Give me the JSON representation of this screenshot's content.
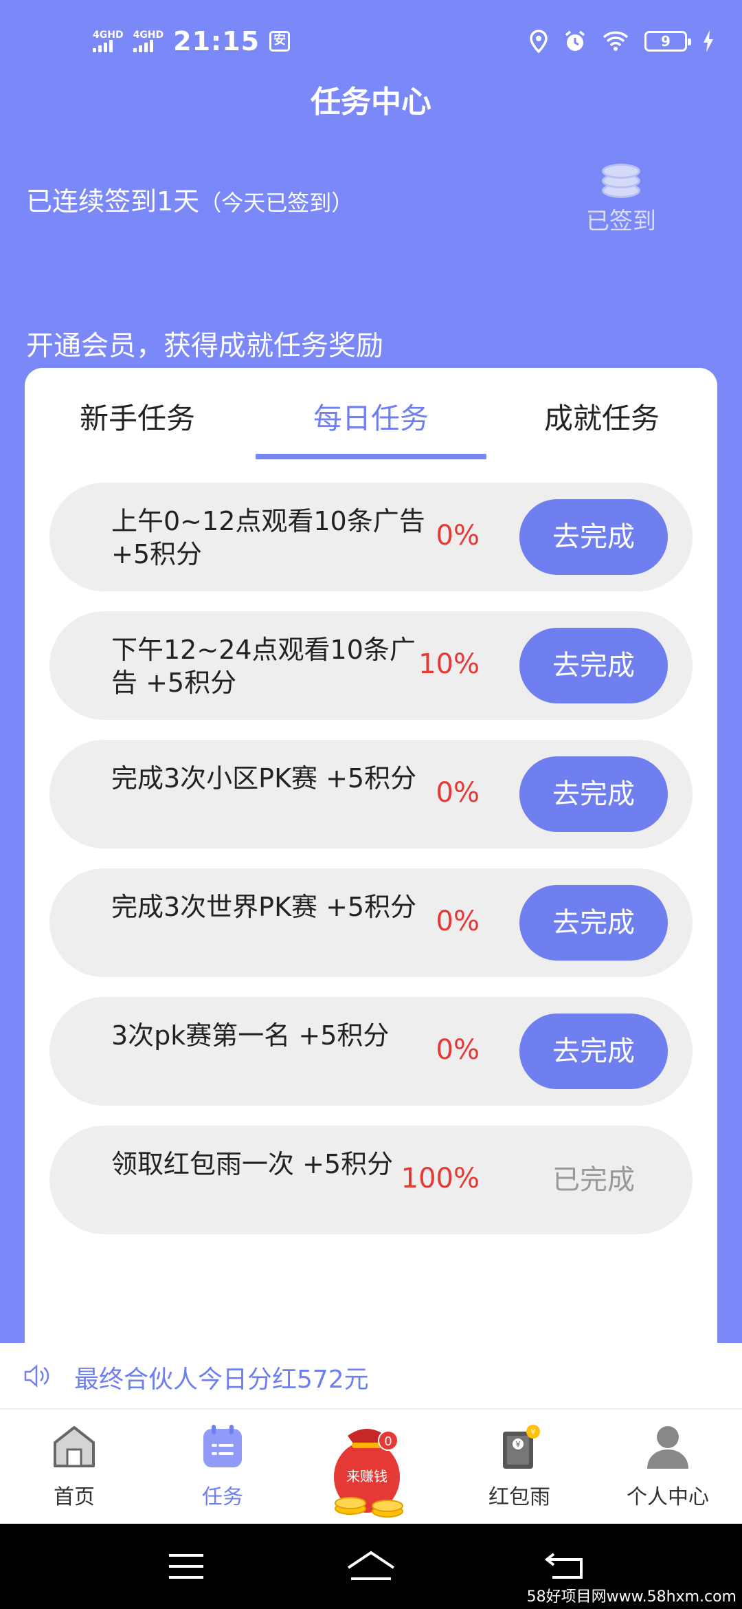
{
  "status_bar": {
    "network_1": "4GHD",
    "network_2": "4GHD",
    "time": "21:15",
    "app_icon_glyph": "安",
    "battery": "9",
    "icons": [
      "location-icon",
      "alarm-icon",
      "wifi-icon",
      "battery-icon",
      "charging-icon"
    ]
  },
  "header": {
    "title": "任务中心"
  },
  "checkin": {
    "text": "已连续签到1天",
    "note": "（今天已签到）",
    "button_label": "已签到"
  },
  "promo_text": "开通会员，获得成就任务奖励",
  "tabs": [
    {
      "label": "新手任务",
      "active": false
    },
    {
      "label": "每日任务",
      "active": true
    },
    {
      "label": "成就任务",
      "active": false
    }
  ],
  "tasks": [
    {
      "title": "上午0~12点观看10条广告  +5积分",
      "progress": "0%",
      "action": "去完成",
      "done": false
    },
    {
      "title": "下午12~24点观看10条广告  +5积分",
      "progress": "10%",
      "action": "去完成",
      "done": false
    },
    {
      "title": "完成3次小区PK赛  +5积分",
      "progress": "0%",
      "action": "去完成",
      "done": false
    },
    {
      "title": "完成3次世界PK赛  +5积分",
      "progress": "0%",
      "action": "去完成",
      "done": false
    },
    {
      "title": "3次pk赛第一名  +5积分",
      "progress": "0%",
      "action": "去完成",
      "done": false
    },
    {
      "title": "领取红包雨一次  +5积分",
      "progress": "100%",
      "action": "已完成",
      "done": true
    }
  ],
  "announcement": "最终合伙人今日分红572元",
  "bottom_nav": [
    {
      "label": "首页",
      "icon": "home-icon",
      "active": false
    },
    {
      "label": "任务",
      "icon": "task-icon",
      "active": true
    },
    {
      "label": "",
      "icon": "money-bag-icon",
      "bag_text": "来赚钱",
      "badge": "0",
      "active": false
    },
    {
      "label": "红包雨",
      "icon": "red-envelope-icon",
      "active": false
    },
    {
      "label": "个人中心",
      "icon": "user-icon",
      "active": false
    }
  ],
  "watermark": "58好项目网www.58hxm.com",
  "colors": {
    "primary": "#7b88f7",
    "accent": "#6f7ff0",
    "progress_red": "#e53935"
  }
}
